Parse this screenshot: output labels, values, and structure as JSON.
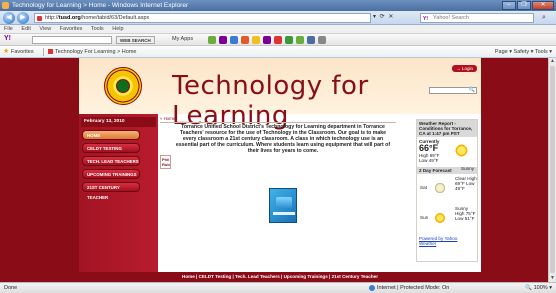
{
  "window": {
    "title": "Technology for Learning > Home - Windows Internet Explorer",
    "buttons": [
      "–",
      "❐",
      "✕"
    ]
  },
  "address": {
    "url_prefix": "http://",
    "url_host": "tusd.org",
    "url_path": "/home/tabid/63/Default.aspx",
    "search_placeholder": "Yahoo! Search",
    "tools": "▾ ⟳ ✕"
  },
  "menu": [
    "File",
    "Edit",
    "View",
    "Favorites",
    "Tools",
    "Help"
  ],
  "toolbar": {
    "logo": "Y!",
    "web_search_label": "WEB SEARCH",
    "my_apps_label": "My Apps"
  },
  "favorites": {
    "label": "Favorites",
    "tab_title": "Technology For Learning > Home",
    "commands": "Page ▾   Safety ▾   Tools ▾"
  },
  "site": {
    "title": "Technology for Learning",
    "login_label": "Login",
    "date": "February 13, 2010",
    "breadcrumb": "» Home",
    "nav": [
      {
        "label": "HOME",
        "active": true
      },
      {
        "label": "CELDT TESTING",
        "active": false
      },
      {
        "label": "TECH. LEAD TEACHERS",
        "active": false
      },
      {
        "label": "UPCOMING TRAININGS",
        "active": false
      },
      {
        "label": "21ST CENTURY TEACHER",
        "active": false
      }
    ],
    "subnav": [
      "Phil",
      "Rob"
    ],
    "intro": "Torrance Unified School District's Technology for Learning department in Torrance Teachers' resource for the use of Technology in the Classroom. Our goal is to make every classroom a 21st century classroom. A class in which technology use is an essential part of the curriculum. Where students learn using equipment that will part of their lives for years to come.",
    "weather": {
      "header": "Weather Report - Conditions for Torrance, CA at 1:47 pm PST",
      "currently_label": "Currently",
      "current_temp": "66°F",
      "high": "High 69°F",
      "low": "Low 49°F",
      "condition": "Sunny",
      "forecast_header": "2 Day Forecast",
      "days": [
        {
          "day": "Sat",
          "text": "Clear High 69°F Low 49°F",
          "icon": "moon-icon"
        },
        {
          "day": "Sun",
          "text": "Sunny High 75°F Low 51°F",
          "icon": "sun-icon"
        }
      ],
      "powered": "Powered by Yahoo Weather"
    },
    "footer": "Home | CELDT Testing | Tech. Lead Teachers | Upcoming Trainings | 21st Century Teacher"
  },
  "status": {
    "left": "Done",
    "zone": "Internet | Protected Mode: On",
    "zoom": "100%"
  },
  "colors": {
    "brand": "#8a0c16",
    "nav_active": "#e07a30",
    "header_bg": "#fbe5c9"
  }
}
